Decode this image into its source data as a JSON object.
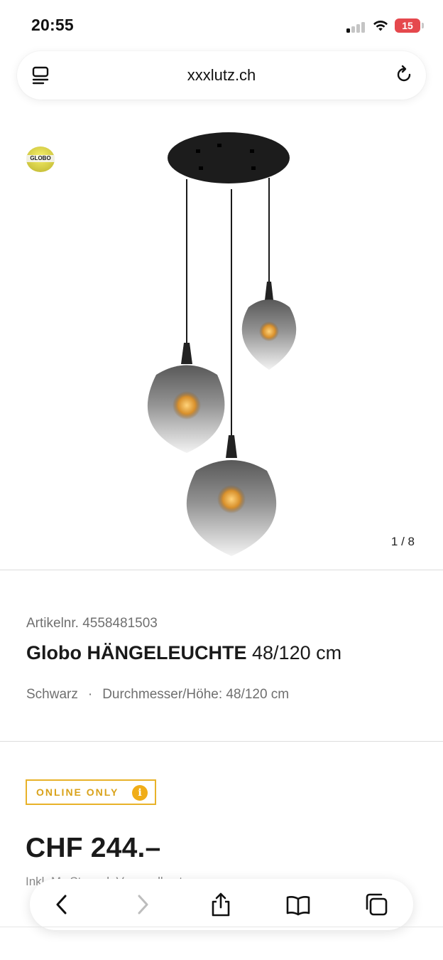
{
  "status_bar": {
    "time": "20:55",
    "battery_level": "15",
    "battery_color": "#e5484d"
  },
  "browser": {
    "url": "xxxlutz.ch",
    "icons": [
      "reader-mode-icon",
      "reload-icon"
    ]
  },
  "gallery": {
    "counter": "1 / 8",
    "brand_logo_text": "GLOBO"
  },
  "product": {
    "article_number": "Artikelnr. 4558481503",
    "title_bold": "Globo HÄNGELEUCHTE",
    "title_size": "48/120 cm",
    "color": "Schwarz",
    "separator": "·",
    "dimensions": "Durchmesser/Höhe: 48/120 cm",
    "badge": "ONLINE ONLY",
    "badge_info": "i",
    "price": "CHF 244.–",
    "vat_note": "Inkl. MwSt. zzgl. Versandkosten"
  },
  "toolbar": {
    "icons": [
      "back-icon",
      "forward-icon",
      "share-icon",
      "bookmarks-icon",
      "tabs-icon"
    ]
  },
  "colors": {
    "accent": "#f0ad18",
    "badge_border": "#e8b229",
    "text": "#1a1a1a",
    "muted": "#6f6f6f"
  }
}
